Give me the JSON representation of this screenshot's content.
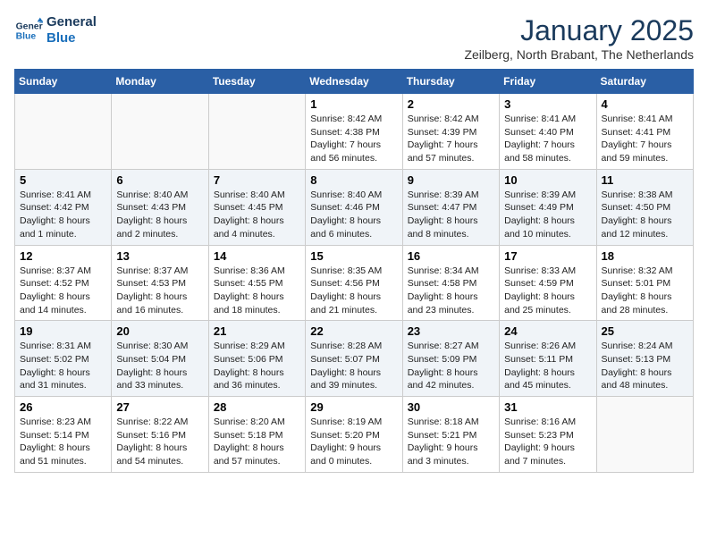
{
  "logo": {
    "general": "General",
    "blue": "Blue"
  },
  "title": "January 2025",
  "subtitle": "Zeilberg, North Brabant, The Netherlands",
  "headers": [
    "Sunday",
    "Monday",
    "Tuesday",
    "Wednesday",
    "Thursday",
    "Friday",
    "Saturday"
  ],
  "weeks": [
    [
      {
        "day": "",
        "info": ""
      },
      {
        "day": "",
        "info": ""
      },
      {
        "day": "",
        "info": ""
      },
      {
        "day": "1",
        "info": "Sunrise: 8:42 AM\nSunset: 4:38 PM\nDaylight: 7 hours and 56 minutes."
      },
      {
        "day": "2",
        "info": "Sunrise: 8:42 AM\nSunset: 4:39 PM\nDaylight: 7 hours and 57 minutes."
      },
      {
        "day": "3",
        "info": "Sunrise: 8:41 AM\nSunset: 4:40 PM\nDaylight: 7 hours and 58 minutes."
      },
      {
        "day": "4",
        "info": "Sunrise: 8:41 AM\nSunset: 4:41 PM\nDaylight: 7 hours and 59 minutes."
      }
    ],
    [
      {
        "day": "5",
        "info": "Sunrise: 8:41 AM\nSunset: 4:42 PM\nDaylight: 8 hours and 1 minute."
      },
      {
        "day": "6",
        "info": "Sunrise: 8:40 AM\nSunset: 4:43 PM\nDaylight: 8 hours and 2 minutes."
      },
      {
        "day": "7",
        "info": "Sunrise: 8:40 AM\nSunset: 4:45 PM\nDaylight: 8 hours and 4 minutes."
      },
      {
        "day": "8",
        "info": "Sunrise: 8:40 AM\nSunset: 4:46 PM\nDaylight: 8 hours and 6 minutes."
      },
      {
        "day": "9",
        "info": "Sunrise: 8:39 AM\nSunset: 4:47 PM\nDaylight: 8 hours and 8 minutes."
      },
      {
        "day": "10",
        "info": "Sunrise: 8:39 AM\nSunset: 4:49 PM\nDaylight: 8 hours and 10 minutes."
      },
      {
        "day": "11",
        "info": "Sunrise: 8:38 AM\nSunset: 4:50 PM\nDaylight: 8 hours and 12 minutes."
      }
    ],
    [
      {
        "day": "12",
        "info": "Sunrise: 8:37 AM\nSunset: 4:52 PM\nDaylight: 8 hours and 14 minutes."
      },
      {
        "day": "13",
        "info": "Sunrise: 8:37 AM\nSunset: 4:53 PM\nDaylight: 8 hours and 16 minutes."
      },
      {
        "day": "14",
        "info": "Sunrise: 8:36 AM\nSunset: 4:55 PM\nDaylight: 8 hours and 18 minutes."
      },
      {
        "day": "15",
        "info": "Sunrise: 8:35 AM\nSunset: 4:56 PM\nDaylight: 8 hours and 21 minutes."
      },
      {
        "day": "16",
        "info": "Sunrise: 8:34 AM\nSunset: 4:58 PM\nDaylight: 8 hours and 23 minutes."
      },
      {
        "day": "17",
        "info": "Sunrise: 8:33 AM\nSunset: 4:59 PM\nDaylight: 8 hours and 25 minutes."
      },
      {
        "day": "18",
        "info": "Sunrise: 8:32 AM\nSunset: 5:01 PM\nDaylight: 8 hours and 28 minutes."
      }
    ],
    [
      {
        "day": "19",
        "info": "Sunrise: 8:31 AM\nSunset: 5:02 PM\nDaylight: 8 hours and 31 minutes."
      },
      {
        "day": "20",
        "info": "Sunrise: 8:30 AM\nSunset: 5:04 PM\nDaylight: 8 hours and 33 minutes."
      },
      {
        "day": "21",
        "info": "Sunrise: 8:29 AM\nSunset: 5:06 PM\nDaylight: 8 hours and 36 minutes."
      },
      {
        "day": "22",
        "info": "Sunrise: 8:28 AM\nSunset: 5:07 PM\nDaylight: 8 hours and 39 minutes."
      },
      {
        "day": "23",
        "info": "Sunrise: 8:27 AM\nSunset: 5:09 PM\nDaylight: 8 hours and 42 minutes."
      },
      {
        "day": "24",
        "info": "Sunrise: 8:26 AM\nSunset: 5:11 PM\nDaylight: 8 hours and 45 minutes."
      },
      {
        "day": "25",
        "info": "Sunrise: 8:24 AM\nSunset: 5:13 PM\nDaylight: 8 hours and 48 minutes."
      }
    ],
    [
      {
        "day": "26",
        "info": "Sunrise: 8:23 AM\nSunset: 5:14 PM\nDaylight: 8 hours and 51 minutes."
      },
      {
        "day": "27",
        "info": "Sunrise: 8:22 AM\nSunset: 5:16 PM\nDaylight: 8 hours and 54 minutes."
      },
      {
        "day": "28",
        "info": "Sunrise: 8:20 AM\nSunset: 5:18 PM\nDaylight: 8 hours and 57 minutes."
      },
      {
        "day": "29",
        "info": "Sunrise: 8:19 AM\nSunset: 5:20 PM\nDaylight: 9 hours and 0 minutes."
      },
      {
        "day": "30",
        "info": "Sunrise: 8:18 AM\nSunset: 5:21 PM\nDaylight: 9 hours and 3 minutes."
      },
      {
        "day": "31",
        "info": "Sunrise: 8:16 AM\nSunset: 5:23 PM\nDaylight: 9 hours and 7 minutes."
      },
      {
        "day": "",
        "info": ""
      }
    ]
  ]
}
